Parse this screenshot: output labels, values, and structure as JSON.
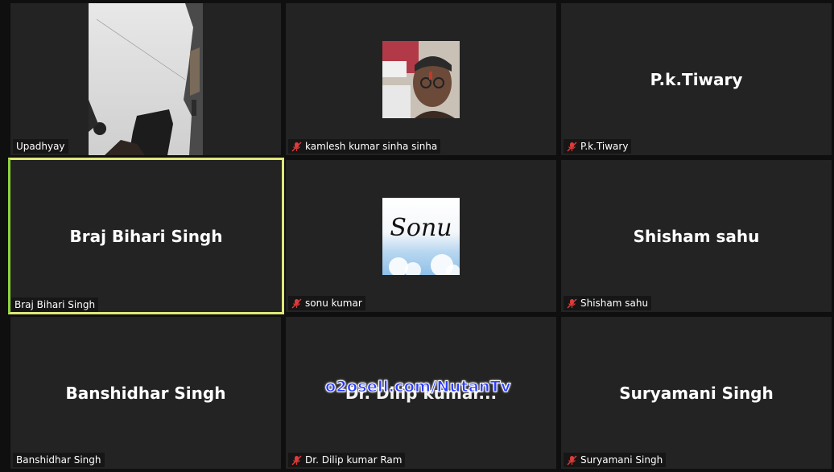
{
  "tiles": [
    {
      "display_name": "",
      "label": "Upadhyay",
      "muted": false
    },
    {
      "display_name": "",
      "label": "kamlesh kumar sinha sinha",
      "muted": true
    },
    {
      "display_name": "P.k.Tiwary",
      "label": "P.k.Tiwary",
      "muted": true
    },
    {
      "display_name": "Braj Bihari Singh",
      "label": "Braj Bihari Singh",
      "muted": false,
      "active_speaker": true
    },
    {
      "display_name": "",
      "label": "sonu kumar",
      "muted": true,
      "avatar_text": "Sonu"
    },
    {
      "display_name": "Shisham sahu",
      "label": "Shisham sahu",
      "muted": true
    },
    {
      "display_name": "Banshidhar Singh",
      "label": "Banshidhar Singh",
      "muted": false
    },
    {
      "display_name": "Dr. Dilip kumar...",
      "label": "Dr. Dilip kumar Ram",
      "muted": true
    },
    {
      "display_name": "Suryamani Singh",
      "label": "Suryamani Singh",
      "muted": true
    }
  ],
  "watermark": "o2osell.com/NutanTv",
  "colors": {
    "tile_bg": "#232323",
    "active_border": "#e0e87a",
    "mute_icon": "#e03a3a",
    "watermark_fill": "#2a3bff"
  },
  "icons": {
    "mute": "microphone-muted-icon"
  }
}
